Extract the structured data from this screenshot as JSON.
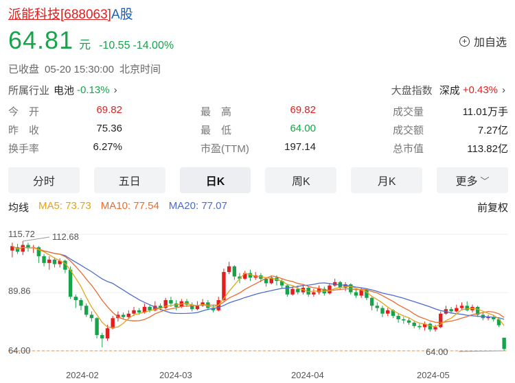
{
  "title": {
    "name_code": "派能科技[688063]",
    "suffix": "A股"
  },
  "quote": {
    "price": "64.81",
    "unit": "元",
    "change": "-10.55",
    "change_pct": "-14.00%"
  },
  "watch": {
    "label": "加自选"
  },
  "status": {
    "state": "已收盘",
    "time": "05-20 15:30:00",
    "zone": "北京时间"
  },
  "industry": {
    "label": "所属行业",
    "name": "电池",
    "pct": "-0.13%"
  },
  "market": {
    "label": "大盘指数",
    "name": "深成",
    "pct": "+0.43%"
  },
  "stats": {
    "open_label": "今　开",
    "open": "69.82",
    "high_label": "最　高",
    "high": "69.82",
    "volume_label": "成交量",
    "volume": "11.01万手",
    "prev_label": "昨　收",
    "prev": "75.36",
    "low_label": "最　低",
    "low": "64.00",
    "amount_label": "成交额",
    "amount": "7.27亿",
    "turnover_label": "换手率",
    "turnover": "6.27%",
    "pe_label": "市盈(TTM)",
    "pe": "197.14",
    "mcap_label": "总市值",
    "mcap": "113.82亿"
  },
  "tabs": [
    "分时",
    "五日",
    "日K",
    "周K",
    "月K",
    "更多"
  ],
  "ma": {
    "title": "均线",
    "ma5": "MA5: 73.73",
    "ma10": "MA10: 77.54",
    "ma20": "MA20: 77.07",
    "adjust": "前复权"
  },
  "colors": {
    "up": "#e02020",
    "down": "#16a34a",
    "ma5": "#e3a21a",
    "ma10": "#ea6b2c",
    "ma20": "#4a6bd1"
  },
  "chart_data": {
    "type": "candlestick",
    "y_labels": [
      "115.72",
      "89.86",
      "64.00"
    ],
    "max_marker": "112.68",
    "min_marker": "64.00",
    "x_labels": [
      "2024-02",
      "2024-03",
      "2024-04",
      "2024-05"
    ],
    "ylim": [
      64.0,
      115.72
    ],
    "candles": [
      {
        "o": 108.5,
        "c": 110.5,
        "h": 112.0,
        "l": 105.5
      },
      {
        "o": 110.0,
        "c": 108.0,
        "h": 111.5,
        "l": 107.0
      },
      {
        "o": 108.0,
        "c": 111.0,
        "h": 112.68,
        "l": 106.5
      },
      {
        "o": 111.0,
        "c": 109.5,
        "h": 112.0,
        "l": 108.0
      },
      {
        "o": 109.5,
        "c": 110.0,
        "h": 111.0,
        "l": 107.5
      },
      {
        "o": 110.0,
        "c": 106.0,
        "h": 110.5,
        "l": 103.0
      },
      {
        "o": 106.0,
        "c": 103.0,
        "h": 107.0,
        "l": 101.5
      },
      {
        "o": 103.0,
        "c": 104.5,
        "h": 106.0,
        "l": 100.0
      },
      {
        "o": 104.5,
        "c": 102.5,
        "h": 105.5,
        "l": 101.0
      },
      {
        "o": 102.5,
        "c": 104.0,
        "h": 105.0,
        "l": 101.0
      },
      {
        "o": 104.0,
        "c": 100.0,
        "h": 104.5,
        "l": 98.5
      },
      {
        "o": 100.0,
        "c": 88.0,
        "h": 101.5,
        "l": 87.0
      },
      {
        "o": 88.0,
        "c": 86.5,
        "h": 89.0,
        "l": 83.0
      },
      {
        "o": 86.5,
        "c": 84.0,
        "h": 87.5,
        "l": 82.0
      },
      {
        "o": 84.0,
        "c": 80.0,
        "h": 85.0,
        "l": 79.0
      },
      {
        "o": 80.0,
        "c": 78.5,
        "h": 81.5,
        "l": 77.0
      },
      {
        "o": 78.5,
        "c": 71.0,
        "h": 79.0,
        "l": 69.5
      },
      {
        "o": 71.0,
        "c": 69.5,
        "h": 72.0,
        "l": 65.5
      },
      {
        "o": 69.5,
        "c": 74.0,
        "h": 75.5,
        "l": 68.5
      },
      {
        "o": 74.0,
        "c": 78.5,
        "h": 79.5,
        "l": 73.5
      },
      {
        "o": 78.5,
        "c": 80.0,
        "h": 81.5,
        "l": 77.0
      },
      {
        "o": 80.0,
        "c": 79.0,
        "h": 81.0,
        "l": 78.0
      },
      {
        "o": 79.0,
        "c": 80.5,
        "h": 82.0,
        "l": 78.0
      },
      {
        "o": 80.5,
        "c": 82.0,
        "h": 83.5,
        "l": 79.5
      },
      {
        "o": 82.0,
        "c": 81.0,
        "h": 83.0,
        "l": 80.0
      },
      {
        "o": 81.0,
        "c": 83.5,
        "h": 85.0,
        "l": 80.5
      },
      {
        "o": 83.5,
        "c": 82.0,
        "h": 84.5,
        "l": 81.0
      },
      {
        "o": 82.0,
        "c": 84.0,
        "h": 86.0,
        "l": 81.5
      },
      {
        "o": 84.0,
        "c": 83.0,
        "h": 85.0,
        "l": 82.0
      },
      {
        "o": 83.0,
        "c": 86.5,
        "h": 87.5,
        "l": 82.5
      },
      {
        "o": 86.5,
        "c": 85.0,
        "h": 88.0,
        "l": 83.5
      },
      {
        "o": 85.0,
        "c": 83.5,
        "h": 86.5,
        "l": 82.0
      },
      {
        "o": 83.5,
        "c": 86.0,
        "h": 87.0,
        "l": 83.0
      },
      {
        "o": 86.0,
        "c": 84.5,
        "h": 87.0,
        "l": 83.5
      },
      {
        "o": 84.5,
        "c": 82.5,
        "h": 85.5,
        "l": 81.5
      },
      {
        "o": 82.5,
        "c": 84.0,
        "h": 86.0,
        "l": 82.0
      },
      {
        "o": 84.0,
        "c": 85.5,
        "h": 87.0,
        "l": 83.5
      },
      {
        "o": 85.5,
        "c": 83.0,
        "h": 86.5,
        "l": 82.0
      },
      {
        "o": 83.0,
        "c": 82.0,
        "h": 84.5,
        "l": 81.0
      },
      {
        "o": 82.0,
        "c": 86.5,
        "h": 88.0,
        "l": 81.5
      },
      {
        "o": 86.5,
        "c": 99.0,
        "h": 100.5,
        "l": 86.0
      },
      {
        "o": 99.0,
        "c": 101.5,
        "h": 103.5,
        "l": 98.0
      },
      {
        "o": 101.5,
        "c": 97.0,
        "h": 102.0,
        "l": 95.5
      },
      {
        "o": 97.0,
        "c": 96.0,
        "h": 98.5,
        "l": 94.0
      },
      {
        "o": 96.0,
        "c": 98.5,
        "h": 99.5,
        "l": 95.5
      },
      {
        "o": 98.5,
        "c": 96.5,
        "h": 100.0,
        "l": 95.0
      },
      {
        "o": 96.5,
        "c": 97.5,
        "h": 99.0,
        "l": 95.5
      },
      {
        "o": 97.5,
        "c": 96.0,
        "h": 98.5,
        "l": 94.5
      },
      {
        "o": 96.0,
        "c": 94.0,
        "h": 96.5,
        "l": 92.5
      },
      {
        "o": 94.0,
        "c": 96.5,
        "h": 97.0,
        "l": 93.5
      },
      {
        "o": 96.5,
        "c": 95.0,
        "h": 97.5,
        "l": 93.0
      },
      {
        "o": 95.0,
        "c": 93.0,
        "h": 96.0,
        "l": 91.5
      },
      {
        "o": 93.0,
        "c": 89.0,
        "h": 93.5,
        "l": 88.0
      },
      {
        "o": 89.0,
        "c": 91.5,
        "h": 92.5,
        "l": 88.5
      },
      {
        "o": 91.5,
        "c": 90.0,
        "h": 93.0,
        "l": 89.0
      },
      {
        "o": 90.0,
        "c": 92.0,
        "h": 93.5,
        "l": 89.0
      },
      {
        "o": 92.0,
        "c": 89.0,
        "h": 92.5,
        "l": 88.0
      },
      {
        "o": 89.0,
        "c": 90.0,
        "h": 91.5,
        "l": 88.0
      },
      {
        "o": 90.0,
        "c": 91.5,
        "h": 93.0,
        "l": 89.0
      },
      {
        "o": 91.5,
        "c": 89.5,
        "h": 92.5,
        "l": 88.5
      },
      {
        "o": 89.5,
        "c": 93.0,
        "h": 94.0,
        "l": 89.0
      },
      {
        "o": 93.0,
        "c": 94.5,
        "h": 96.0,
        "l": 92.5
      },
      {
        "o": 94.5,
        "c": 92.0,
        "h": 95.0,
        "l": 91.0
      },
      {
        "o": 92.0,
        "c": 93.5,
        "h": 94.5,
        "l": 90.5
      },
      {
        "o": 93.5,
        "c": 90.0,
        "h": 94.0,
        "l": 89.0
      },
      {
        "o": 90.0,
        "c": 88.5,
        "h": 91.5,
        "l": 87.5
      },
      {
        "o": 88.5,
        "c": 91.0,
        "h": 92.0,
        "l": 87.5
      },
      {
        "o": 91.0,
        "c": 87.5,
        "h": 91.5,
        "l": 86.5
      },
      {
        "o": 87.5,
        "c": 84.0,
        "h": 88.0,
        "l": 82.0
      },
      {
        "o": 84.0,
        "c": 83.0,
        "h": 85.5,
        "l": 81.5
      },
      {
        "o": 83.0,
        "c": 80.5,
        "h": 84.0,
        "l": 79.0
      },
      {
        "o": 80.5,
        "c": 82.0,
        "h": 83.0,
        "l": 79.5
      },
      {
        "o": 82.0,
        "c": 79.5,
        "h": 82.5,
        "l": 78.5
      },
      {
        "o": 79.5,
        "c": 78.0,
        "h": 80.5,
        "l": 76.5
      },
      {
        "o": 78.0,
        "c": 77.5,
        "h": 79.0,
        "l": 76.0
      },
      {
        "o": 77.5,
        "c": 76.5,
        "h": 78.5,
        "l": 75.5
      },
      {
        "o": 76.5,
        "c": 75.0,
        "h": 77.5,
        "l": 74.0
      },
      {
        "o": 75.0,
        "c": 74.5,
        "h": 76.0,
        "l": 73.5
      },
      {
        "o": 74.5,
        "c": 76.0,
        "h": 77.0,
        "l": 73.0
      },
      {
        "o": 76.0,
        "c": 73.5,
        "h": 76.5,
        "l": 72.5
      },
      {
        "o": 73.5,
        "c": 74.5,
        "h": 75.5,
        "l": 72.5
      },
      {
        "o": 74.5,
        "c": 80.5,
        "h": 81.5,
        "l": 74.0
      },
      {
        "o": 80.5,
        "c": 82.5,
        "h": 84.0,
        "l": 80.0
      },
      {
        "o": 82.5,
        "c": 81.5,
        "h": 83.5,
        "l": 80.5
      },
      {
        "o": 81.5,
        "c": 83.0,
        "h": 84.5,
        "l": 81.0
      },
      {
        "o": 83.0,
        "c": 84.0,
        "h": 85.5,
        "l": 82.0
      },
      {
        "o": 84.0,
        "c": 82.0,
        "h": 86.0,
        "l": 81.5
      },
      {
        "o": 82.0,
        "c": 83.5,
        "h": 84.5,
        "l": 81.0
      },
      {
        "o": 83.5,
        "c": 80.0,
        "h": 84.0,
        "l": 79.0
      },
      {
        "o": 80.0,
        "c": 78.5,
        "h": 81.0,
        "l": 77.5
      },
      {
        "o": 78.5,
        "c": 79.0,
        "h": 80.0,
        "l": 77.5
      },
      {
        "o": 79.0,
        "c": 78.0,
        "h": 80.0,
        "l": 77.0
      },
      {
        "o": 78.0,
        "c": 75.36,
        "h": 78.5,
        "l": 74.5
      },
      {
        "o": 69.82,
        "c": 64.81,
        "h": 69.82,
        "l": 64.0
      }
    ]
  }
}
